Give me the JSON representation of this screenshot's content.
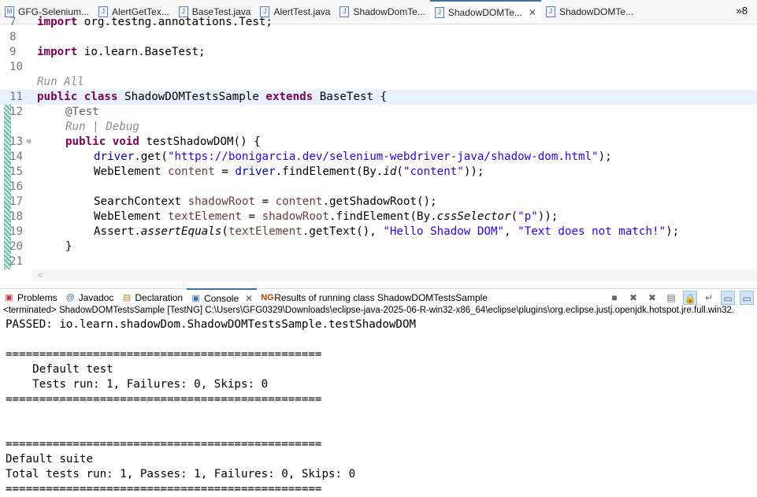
{
  "tabs": [
    {
      "label": "GFG-Selenium...",
      "icon": "maven-pom-icon"
    },
    {
      "label": "AlertGetTex...",
      "icon": "java-file-icon"
    },
    {
      "label": "BaseTest.java",
      "icon": "java-file-icon"
    },
    {
      "label": "AlertTest.java",
      "icon": "java-file-icon"
    },
    {
      "label": "ShadowDomTe...",
      "icon": "java-file-icon"
    },
    {
      "label": "ShadowDOMTe...",
      "icon": "java-file-icon",
      "active": true
    },
    {
      "label": "ShadowDOMTe...",
      "icon": "java-file-icon"
    }
  ],
  "more_tabs": "»8",
  "code": {
    "l7": "import org.testng.annotations.Test;",
    "n7": "7",
    "n8": "8",
    "n9": "9",
    "n10": "10",
    "n11": "11",
    "n12": "12",
    "n13": "13",
    "n14": "14",
    "n15": "15",
    "n16": "16",
    "n17": "17",
    "n18": "18",
    "n19": "19",
    "n20": "20",
    "n21": "21",
    "run_all": "Run All",
    "run_debug": "Run | Debug",
    "l9_kw": "import",
    "l9_rest": " io.learn.BaseTest;",
    "l11a": "public class",
    "l11b": " ShadowDOMTestsSample ",
    "l11c": "extends",
    "l11d": " BaseTest {",
    "l12": "@Test",
    "l13a": "public void",
    "l13b": " testShadowDOM() {",
    "l14a": "driver",
    "l14b": ".get(",
    "l14c": "\"https://bonigarcia.dev/selenium-webdriver-java/shadow-dom.html\"",
    "l14d": ");",
    "l15a": "WebElement ",
    "l15b": "content",
    "l15c": " = ",
    "l15d": "driver",
    "l15e": ".findElement(By.",
    "l15f": "id",
    "l15g": "(",
    "l15h": "\"content\"",
    "l15i": "));",
    "l17a": "SearchContext ",
    "l17b": "shadowRoot",
    "l17c": " = ",
    "l17d": "content",
    "l17e": ".getShadowRoot();",
    "l18a": "WebElement ",
    "l18b": "textElement",
    "l18c": " = ",
    "l18d": "shadowRoot",
    "l18e": ".findElement(By.",
    "l18f": "cssSelector",
    "l18g": "(",
    "l18h": "\"p\"",
    "l18i": "));",
    "l19a": "Assert.",
    "l19b": "assertEquals",
    "l19c": "(",
    "l19d": "textElement",
    "l19e": ".getText(), ",
    "l19f": "\"Hello Shadow DOM\"",
    "l19g": ", ",
    "l19h": "\"Text does not match!\"",
    "l19i": ");",
    "l20": "}"
  },
  "panel": {
    "tabs": [
      "Problems",
      "Javadoc",
      "Declaration",
      "Console",
      "Results of running class ShadowDOMTestsSample"
    ],
    "terminated": "<terminated> ShadowDOMTestsSample [TestNG] C:\\Users\\GFG0329\\Downloads\\eclipse-java-2025-06-R-win32-x86_64\\eclipse\\plugins\\org.eclipse.justj.openjdk.hotspot.jre.full.win32.",
    "output": "PASSED: io.learn.shadowDom.ShadowDOMTestsSample.testShadowDOM\n\n===============================================\n    Default test\n    Tests run: 1, Failures: 0, Skips: 0\n===============================================\n\n\n===============================================\nDefault suite\nTotal tests run: 1, Passes: 1, Failures: 0, Skips: 0\n==============================================="
  }
}
